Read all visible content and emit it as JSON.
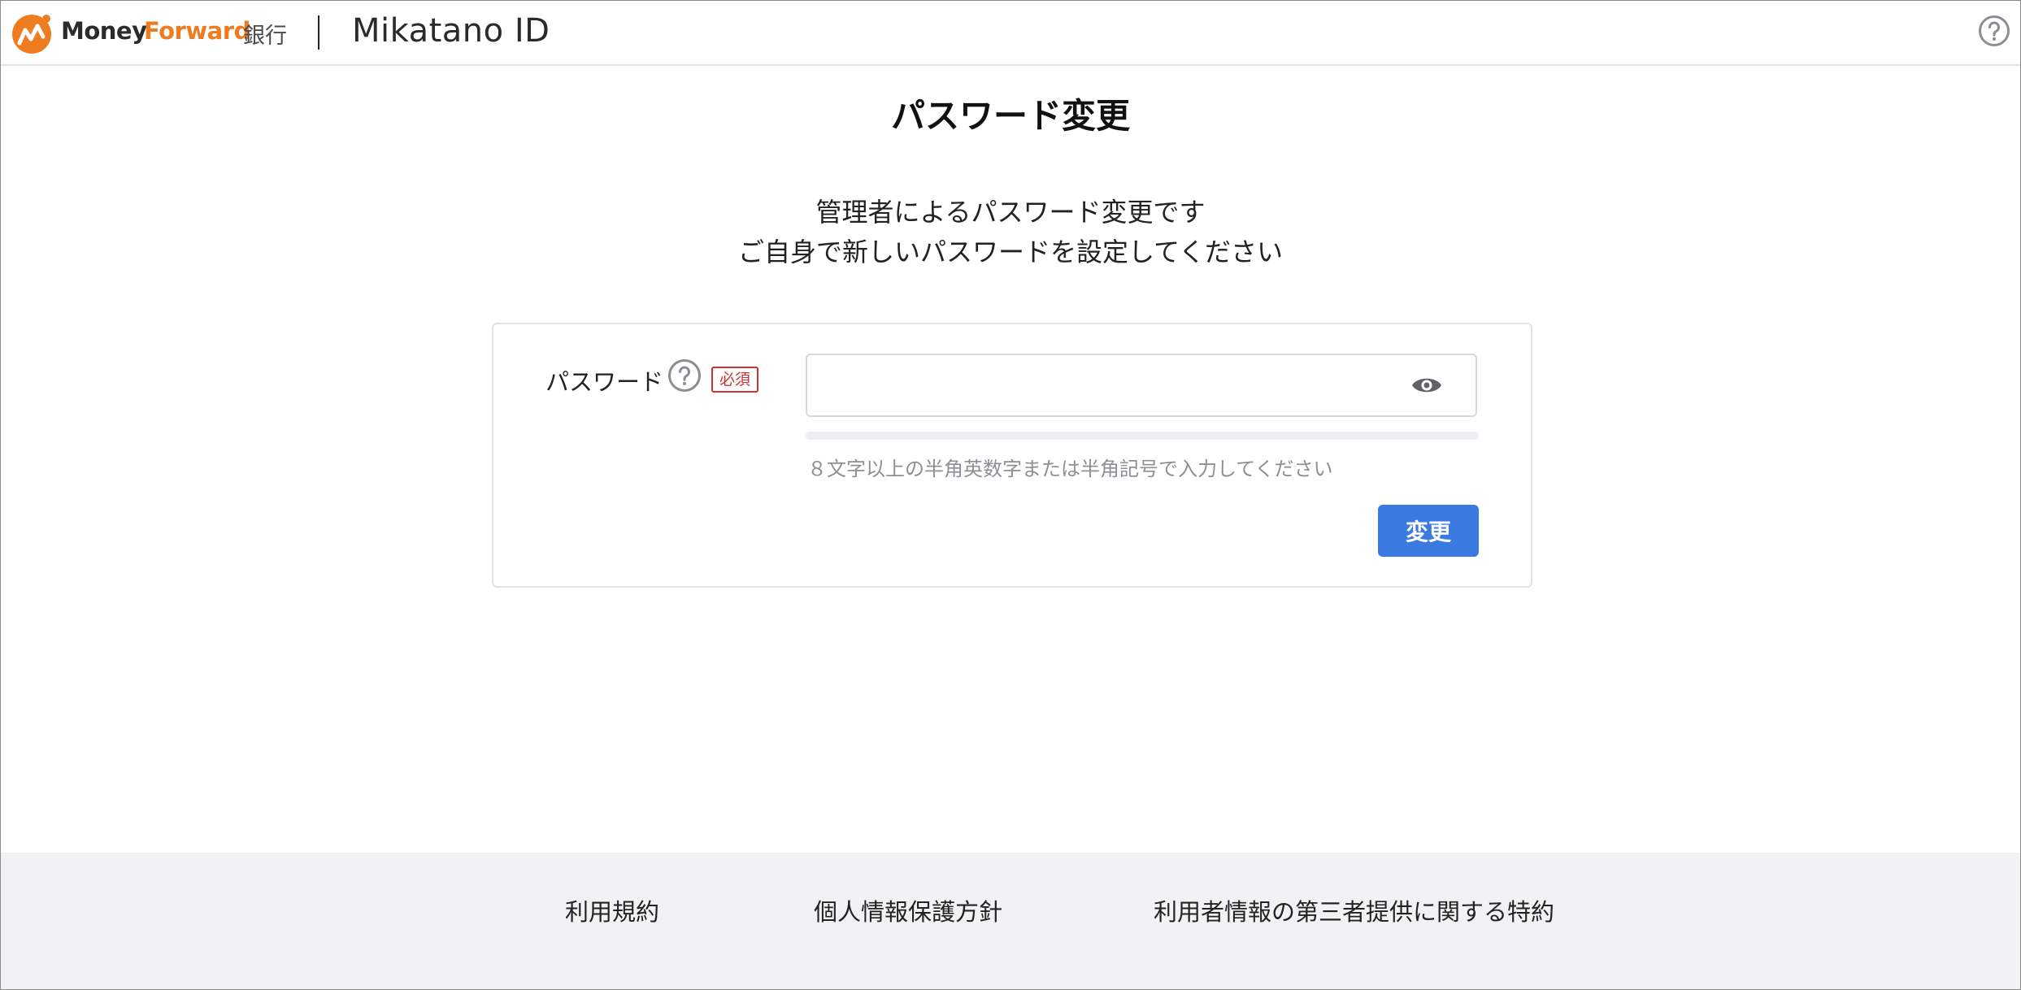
{
  "header": {
    "brand_money": "Money",
    "brand_forward": "Forward",
    "brand_bank": "銀行",
    "brand_mikatano": "Mikatano ID",
    "help_icon": "help-circle-icon",
    "accent_color": "#ee7d22"
  },
  "main": {
    "title": "パスワード変更",
    "subtitle_line1": "管理者によるパスワード変更です",
    "subtitle_line2": "ご自身で新しいパスワードを設定してください"
  },
  "form": {
    "password_label": "パスワード",
    "password_help_icon": "help-circle-icon",
    "required_badge": "必須",
    "password_value": "",
    "password_placeholder": "",
    "visibility_icon": "eye-icon",
    "strength_level": 0,
    "hint": "８文字以上の半角英数字または半角記号で入力してください",
    "submit_label": "変更",
    "button_color": "#3b7ae0"
  },
  "footer": {
    "links": [
      "利用規約",
      "個人情報保護方針",
      "利用者情報の第三者提供に関する特約"
    ]
  }
}
